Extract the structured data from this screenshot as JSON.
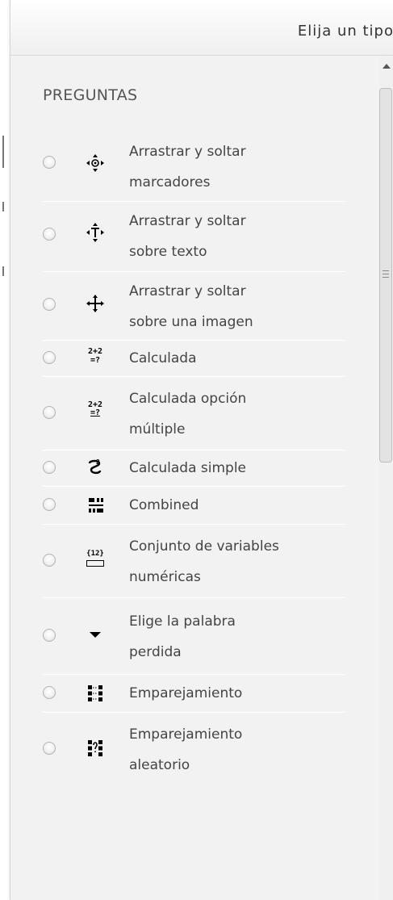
{
  "dialog": {
    "title": "Elija un tipo"
  },
  "section_heading": "PREGUNTAS",
  "items": [
    {
      "line1": "Arrastrar y soltar",
      "line2": "marcadores",
      "icon": "drag-drop-markers-icon"
    },
    {
      "line1": "Arrastrar y soltar",
      "line2": "sobre texto",
      "icon": "drag-drop-text-icon"
    },
    {
      "line1": "Arrastrar y soltar",
      "line2": "sobre una imagen",
      "icon": "drag-drop-image-icon"
    },
    {
      "line1": "Calculada",
      "line2": "",
      "icon": "calculated-icon"
    },
    {
      "line1": "Calculada opción",
      "line2": "múltiple",
      "icon": "calculated-multichoice-icon"
    },
    {
      "line1": "Calculada simple",
      "line2": "",
      "icon": "calculated-simple-icon"
    },
    {
      "line1": "Combined",
      "line2": "",
      "icon": "combined-icon"
    },
    {
      "line1": "Conjunto de variables",
      "line2": "numéricas",
      "icon": "numeric-variables-icon"
    },
    {
      "line1": "Elige la palabra",
      "line2": "perdida",
      "icon": "select-missing-word-icon"
    },
    {
      "line1": "Emparejamiento",
      "line2": "",
      "icon": "matching-icon"
    },
    {
      "line1": "Emparejamiento",
      "line2": "aleatorio",
      "icon": "random-matching-icon"
    }
  ],
  "icon_glyphs": {
    "calc_top": "2+2",
    "calc_bottom": "=?",
    "numeric_vars": "{12}"
  },
  "colors": {
    "panel_bg": "#f2f2f2",
    "separator": "#ffffff",
    "heading": "#555555",
    "label": "#444444"
  }
}
